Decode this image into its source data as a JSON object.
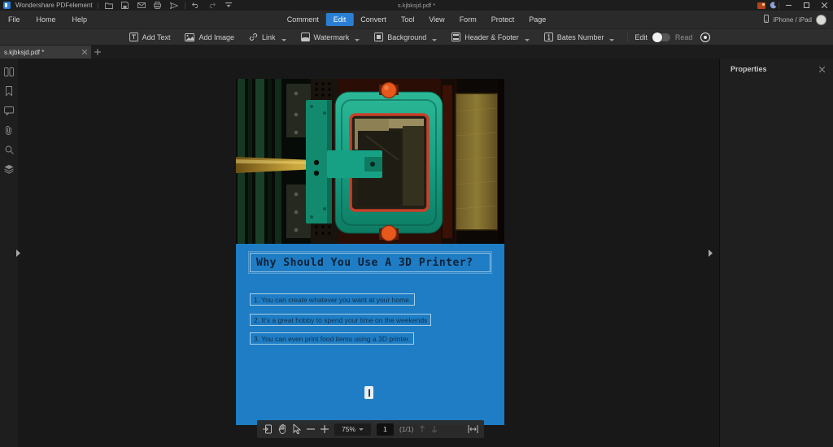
{
  "titlebar": {
    "app_name": "Wondershare PDFelement",
    "document_title": "s.kjbksjd.pdf *"
  },
  "menubar": {
    "menus": [
      {
        "label": "File"
      },
      {
        "label": "Home"
      },
      {
        "label": "Help"
      }
    ],
    "tabs": [
      {
        "label": "Comment",
        "active": false
      },
      {
        "label": "Edit",
        "active": true
      },
      {
        "label": "Convert",
        "active": false
      },
      {
        "label": "Tool",
        "active": false
      },
      {
        "label": "View",
        "active": false
      },
      {
        "label": "Form",
        "active": false
      },
      {
        "label": "Protect",
        "active": false
      },
      {
        "label": "Page",
        "active": false
      }
    ],
    "device_label": "iPhone / iPad"
  },
  "toolbar": {
    "buttons": [
      {
        "label": "Add Text",
        "icon": "add-text-icon",
        "dropdown": false
      },
      {
        "label": "Add Image",
        "icon": "add-image-icon",
        "dropdown": false
      },
      {
        "label": "Link",
        "icon": "link-icon",
        "dropdown": true
      },
      {
        "label": "Watermark",
        "icon": "watermark-icon",
        "dropdown": true
      },
      {
        "label": "Background",
        "icon": "background-icon",
        "dropdown": true
      },
      {
        "label": "Header & Footer",
        "icon": "header-footer-icon",
        "dropdown": true
      },
      {
        "label": "Bates Number",
        "icon": "bates-number-icon",
        "dropdown": true
      }
    ],
    "edit_label": "Edit",
    "read_label": "Read"
  },
  "tabbar": {
    "document_tab": "s.kjbksjd.pdf *"
  },
  "sidebar": {
    "icons": [
      "thumbnails-icon",
      "bookmark-icon",
      "comment-icon",
      "attachment-icon",
      "search-icon",
      "layers-icon"
    ]
  },
  "properties_panel": {
    "title": "Properties"
  },
  "document": {
    "title": "Why Should You Use A 3D Printer?",
    "list_items": [
      "1. You can create whatever you want at  your home.",
      "2. It's a great hobby to spend your time on the weekends",
      "3. You can even print food items using a 3D printer."
    ]
  },
  "statusbar": {
    "zoom_level": "75%",
    "page_number": "1",
    "page_count": "(1/1)"
  },
  "colors": {
    "accent_blue": "#2a7fd4",
    "page_blue": "#1e7dc4",
    "doc_text_navy": "#10304e",
    "knob_orange": "#e8571c",
    "vat_teal": "#1fae8c"
  }
}
